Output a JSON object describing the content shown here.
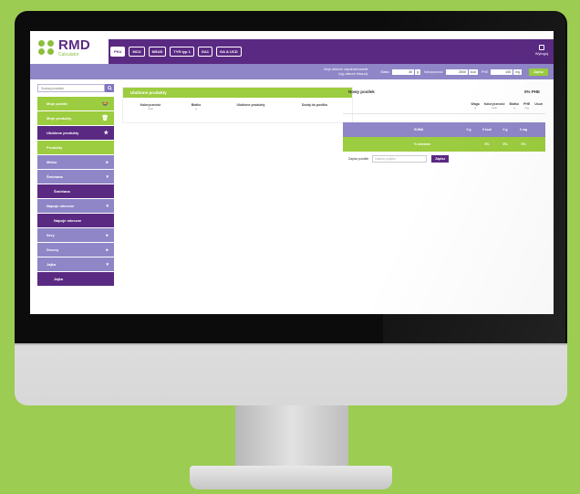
{
  "logo": {
    "title": "RMD",
    "subtitle": "Calculator"
  },
  "nav": {
    "tabs": [
      "PKU",
      "MCU",
      "MSUD",
      "TYR typ 1",
      "GA1",
      "GA & UCD"
    ],
    "active": 0
  },
  "logout_label": "Wyloguj",
  "subbar": {
    "daily_label_1": "Moje dzienne zapotrzebowanie",
    "daily_label_2": "(wg zaleceń lekarza)",
    "bialko_label": "Białko",
    "bialko_value": "30",
    "bialko_unit": "g",
    "kcal_label": "Kaloryczność",
    "kcal_value": "2000",
    "kcal_unit": "kcal",
    "phe_label": "PHE",
    "phe_value": "100",
    "phe_unit": "mg",
    "save_label": "Zapisz"
  },
  "sidebar": {
    "search_placeholder": "Szukaj produktu",
    "items": [
      {
        "label": "Moje posiłki",
        "style": "green",
        "icon": "bowl-icon"
      },
      {
        "label": "Moje produkty",
        "style": "green",
        "icon": "trash-icon"
      },
      {
        "label": "Ulubione produkty",
        "style": "purple",
        "icon": "star-icon"
      },
      {
        "label": "Produkty",
        "style": "green"
      },
      {
        "label": "Mleko",
        "style": "lav",
        "chevron": "▸"
      },
      {
        "label": "Śmietana",
        "style": "lav",
        "chevron": "▾"
      },
      {
        "label": "Śmietana",
        "style": "purple-indent"
      },
      {
        "label": "Napoje mleczne",
        "style": "lav",
        "chevron": "▾"
      },
      {
        "label": "Napoje mleczne",
        "style": "purple-indent"
      },
      {
        "label": "Sery",
        "style": "lav",
        "chevron": "▸"
      },
      {
        "label": "Desery",
        "style": "lav",
        "chevron": "▸"
      },
      {
        "label": "Jajka",
        "style": "lav",
        "chevron": "▾"
      },
      {
        "label": "Jajka",
        "style": "purple-indent"
      }
    ]
  },
  "favorites": {
    "title": "Ulubione produkty",
    "columns": [
      {
        "label": "Kaloryczność",
        "unit": "kcal"
      },
      {
        "label": "Białko",
        "unit": "g"
      },
      {
        "label": "Ulubione produkty",
        "unit": ""
      },
      {
        "label": "Dodaj do posiłku",
        "unit": ""
      }
    ]
  },
  "meal": {
    "title": "Nowy posiłek",
    "phe_pct_label": "0% PHE",
    "columns": [
      {
        "label": "Waga",
        "unit": "g"
      },
      {
        "label": "Kaloryczność",
        "unit": "kcal"
      },
      {
        "label": "Białko",
        "unit": "g"
      },
      {
        "label": "PHE",
        "unit": "mg"
      },
      {
        "label": "Usuń",
        "unit": ""
      }
    ],
    "sum_label": "SUMA",
    "sum_values": [
      "0 g",
      "0 kcal",
      "0 g",
      "0 mg"
    ],
    "pct_label": "% dziennie",
    "pct_values": [
      "0%",
      "0%",
      "0%"
    ],
    "save_meal_label": "Zapisz posiłek",
    "meal_name_placeholder": "Nazwa posiłku",
    "save_button": "Zapisz"
  },
  "colors": {
    "purple": "#5a2a82",
    "lavender": "#8e86c7",
    "green": "#9ccc3f",
    "background": "#9ccc52"
  }
}
